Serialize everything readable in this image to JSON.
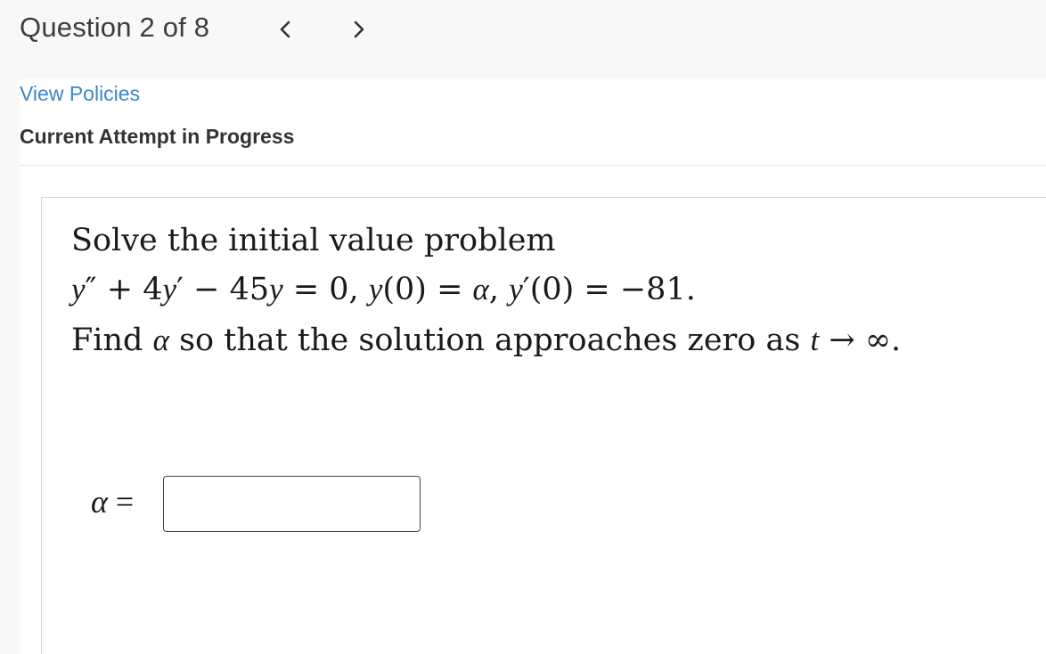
{
  "header": {
    "question_counter": "Question 2 of 8",
    "prev_symbol": "<",
    "next_symbol": ">"
  },
  "links": {
    "view_policies": "View Policies"
  },
  "attempt": {
    "status": "Current Attempt in Progress"
  },
  "question": {
    "line1": "Solve the initial value problem",
    "equation": {
      "ypp": "y",
      "plus4": "+ 4",
      "yp": "y",
      "minus45": "− 45",
      "y": "y",
      "eq0": "= 0,",
      "y0": "y",
      "paren0": "(0) =",
      "alpha": "α",
      "comma": ",",
      "yp0": "y",
      "paren0b": "(0) = −81."
    },
    "line3": {
      "find": "Find",
      "alpha": "α",
      "mid": "so that the solution approaches zero as",
      "t": "t",
      "arrow": "→",
      "infinity": "∞."
    }
  },
  "answer": {
    "label_var": "α",
    "label_eq": "=",
    "value": "",
    "placeholder": ""
  },
  "colors": {
    "link": "#3b86c9",
    "topbar_bg": "#f8f8f8",
    "text": "#333333"
  }
}
